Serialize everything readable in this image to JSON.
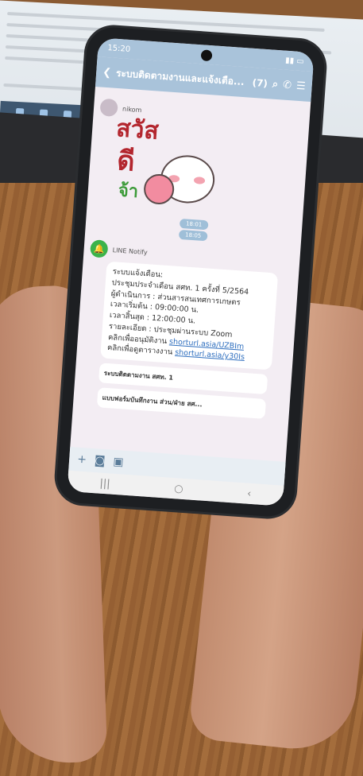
{
  "status_bar": {
    "time": "15:20"
  },
  "chat_header": {
    "back_icon": "chevron-left-icon",
    "title": "ระบบติดตามงานและแจ้งเตือ...",
    "member_count": "(7)",
    "icons": [
      "search-icon",
      "phone-icon",
      "menu-icon"
    ]
  },
  "messages": {
    "sticker_sender": "nikom",
    "sticker_text": [
      "สวัส",
      "ดี",
      "จ้า"
    ],
    "system_time_1": "18:01",
    "system_time_2": "18:05",
    "notify_sender": "LINE Notify",
    "notify_lines": [
      "ระบบแจ้งเตือน:",
      "ประชุมประจำเดือน สศท. 1 ครั้งที่ 5/2564",
      "ผู้ดำเนินการ : ส่วนสารสนเทศการเกษตร",
      "เวลาเริ่มต้น : 09:00:00 น.",
      "เวลาสิ้นสุด : 12:00:00 น.",
      "รายละเอียด : ประชุมผ่านระบบ Zoom"
    ],
    "link_line_1_label": "คลิกเพื่ออนุมัติงาน",
    "link_line_1_url": "shorturl.asia/UZBIm",
    "link_line_2_label": "คลิกเพื่อดูตารางงาน",
    "link_line_2_url": "shorturl.asia/y30Is",
    "card_1_title": "ระบบติดตามงาน สศท. 1",
    "card_2_title": "แบบฟอร์มบันทึกงาน ส่วน/ฝ่าย สศ..."
  },
  "colors": {
    "header_bg": "#a9c3da",
    "line_green": "#3bb34a",
    "link_blue": "#2f6fbf"
  }
}
